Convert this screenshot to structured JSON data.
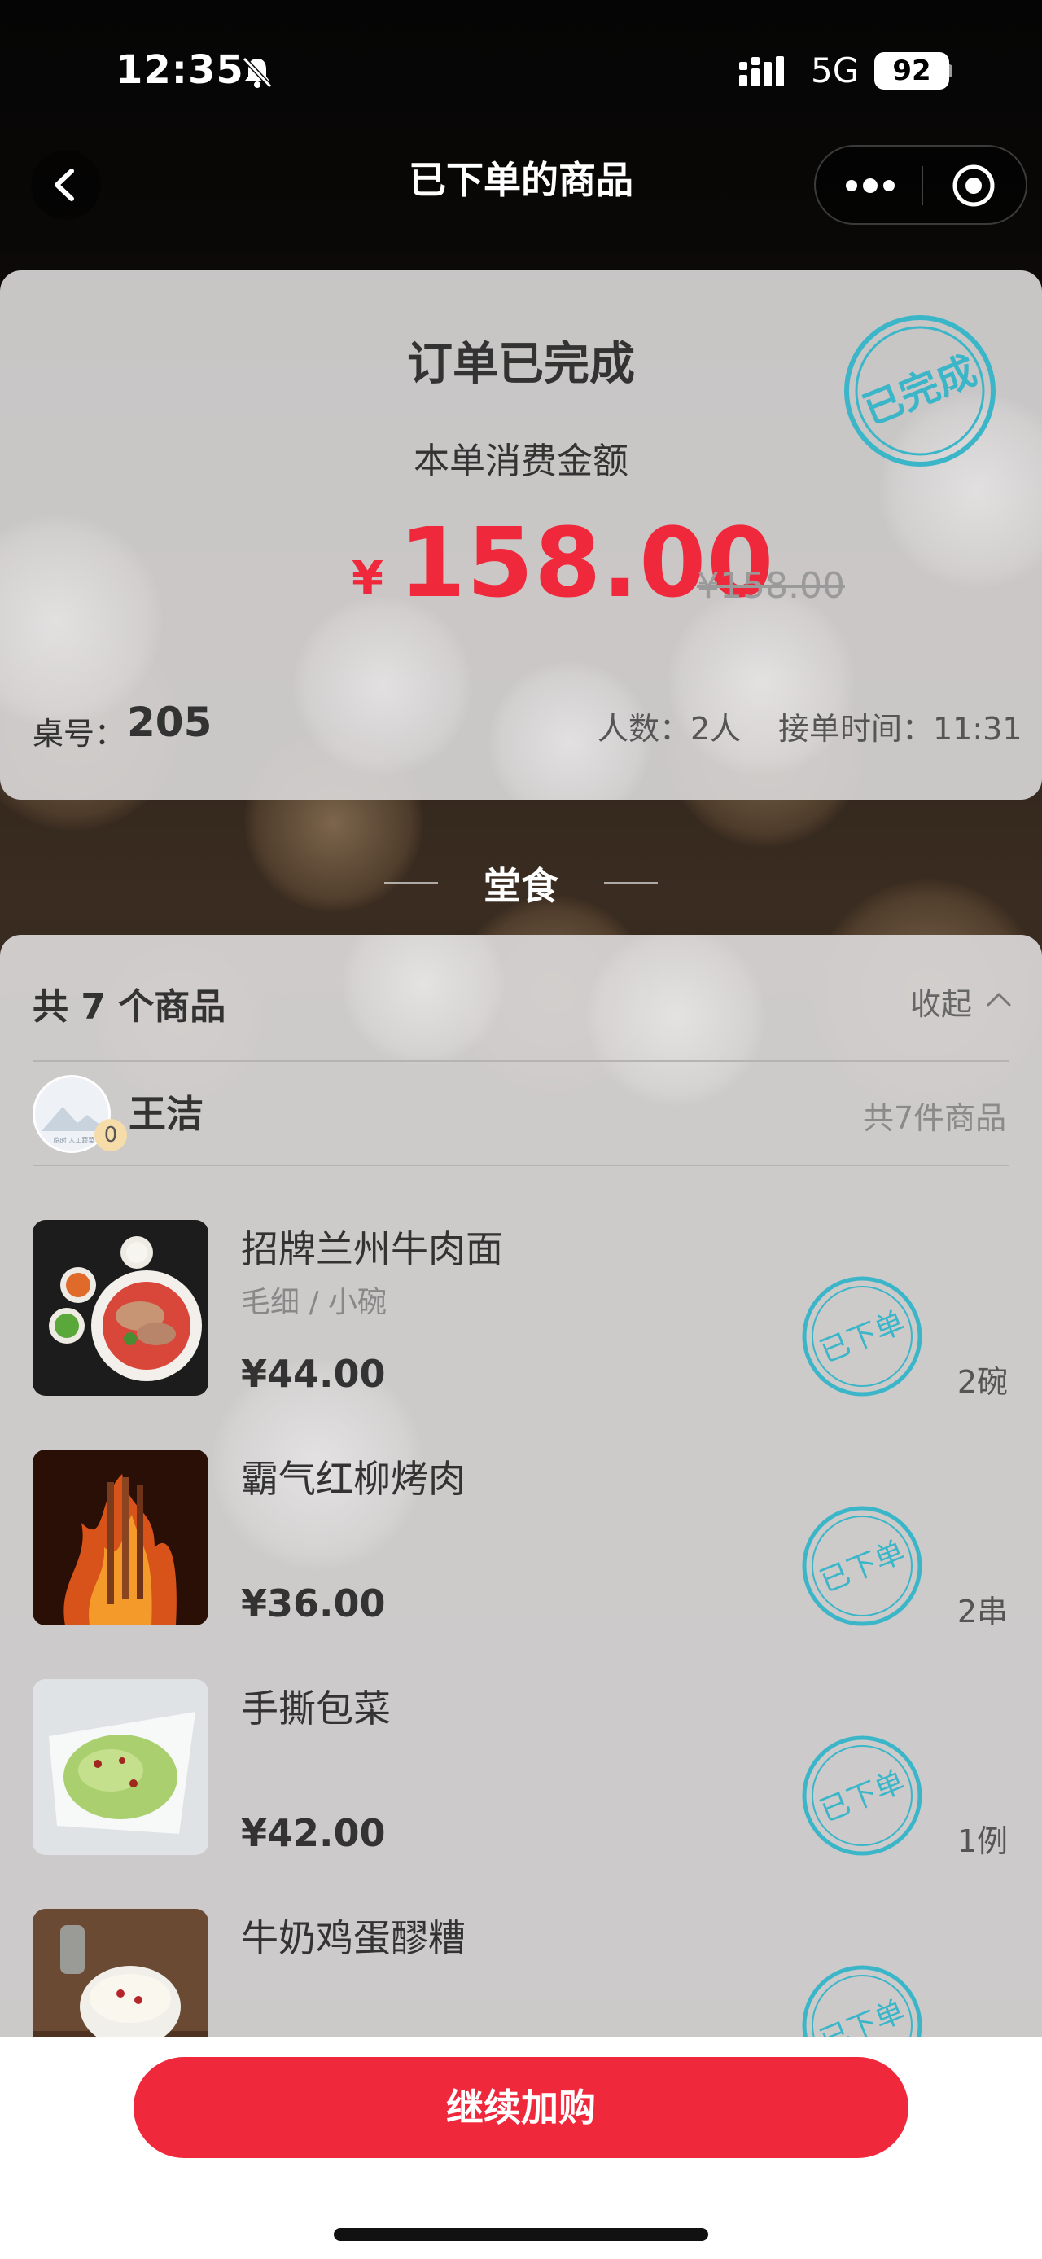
{
  "status_bar": {
    "time": "12:35",
    "network": "5G",
    "battery": "92"
  },
  "nav": {
    "title": "已下单的商品"
  },
  "summary": {
    "status": "订单已完成",
    "stamp_text": "已完成",
    "amount_label": "本单消费金额",
    "currency": "¥",
    "amount": "158.00",
    "original_amount": "¥158.00",
    "table_label": "桌号：",
    "table_number": "205",
    "people": "人数：2人",
    "order_time": "接单时间：11:31"
  },
  "section": {
    "title": "堂食"
  },
  "items_panel": {
    "count_text": "共 7 个商品",
    "collapse_label": "收起",
    "user": {
      "name": "王洁",
      "badge": "0",
      "total": "共7件商品",
      "avatar_caption": "临时 人工蔬菜"
    },
    "stamp_text": "已下单",
    "items": [
      {
        "name": "招牌兰州牛肉面",
        "spec": "毛细 / 小碗",
        "price": "¥44.00",
        "qty": "2碗"
      },
      {
        "name": "霸气红柳烤肉",
        "spec": "",
        "price": "¥36.00",
        "qty": "2串"
      },
      {
        "name": "手撕包菜",
        "spec": "",
        "price": "¥42.00",
        "qty": "1例"
      },
      {
        "name": "牛奶鸡蛋醪糟",
        "spec": "",
        "price": "",
        "qty": ""
      }
    ]
  },
  "bottom": {
    "button_label": "继续加购"
  },
  "colors": {
    "accent": "#f0283c",
    "stamp": "#3bb6c9",
    "card_bg": "#d6d4d4"
  },
  "icons": [
    "bell-slash-icon",
    "signal-icon",
    "back-arrow-icon",
    "more-dots-icon",
    "record-circle-icon",
    "chevron-up-icon"
  ]
}
